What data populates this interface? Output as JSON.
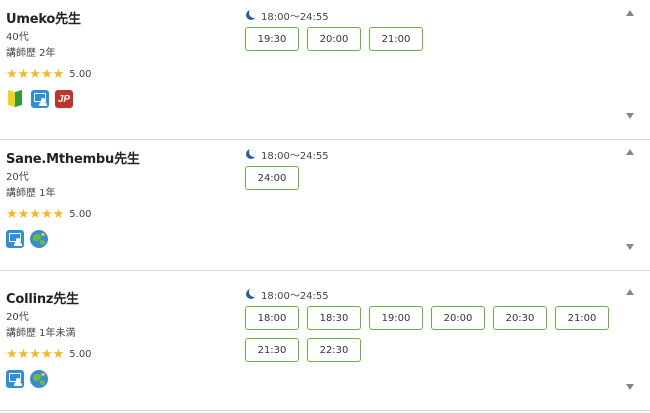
{
  "teachers": [
    {
      "name": "Umeko先生",
      "age": "40代",
      "experience": "講師歴  2年",
      "stars": "★★★★★",
      "score": "5.00",
      "badges": [
        "beginner-mark-icon",
        "teacher-icon",
        "jp-icon"
      ],
      "time_range": "18:00〜24:55",
      "slots": [
        "19:30",
        "20:00",
        "21:00"
      ]
    },
    {
      "name": "Sane.Mthembu先生",
      "age": "20代",
      "experience": "講師歴  1年",
      "stars": "★★★★★",
      "score": "5.00",
      "badges": [
        "teacher-icon",
        "globe-icon"
      ],
      "time_range": "18:00〜24:55",
      "slots": [
        "24:00"
      ]
    },
    {
      "name": "Collinz先生",
      "age": "20代",
      "experience": "講師歴  1年未満",
      "stars": "★★★★★",
      "score": "5.00",
      "badges": [
        "teacher-icon",
        "globe-icon"
      ],
      "time_range": "18:00〜24:55",
      "slots": [
        "18:00",
        "18:30",
        "19:00",
        "20:00",
        "20:30",
        "21:00",
        "21:30",
        "22:30"
      ]
    }
  ],
  "colors": {
    "star": "#f5b81e",
    "slot_border": "#6cb33f",
    "moon": "#2b5ba8",
    "teacher_badge": "#2f8fd8",
    "jp_badge": "#c0352b"
  }
}
